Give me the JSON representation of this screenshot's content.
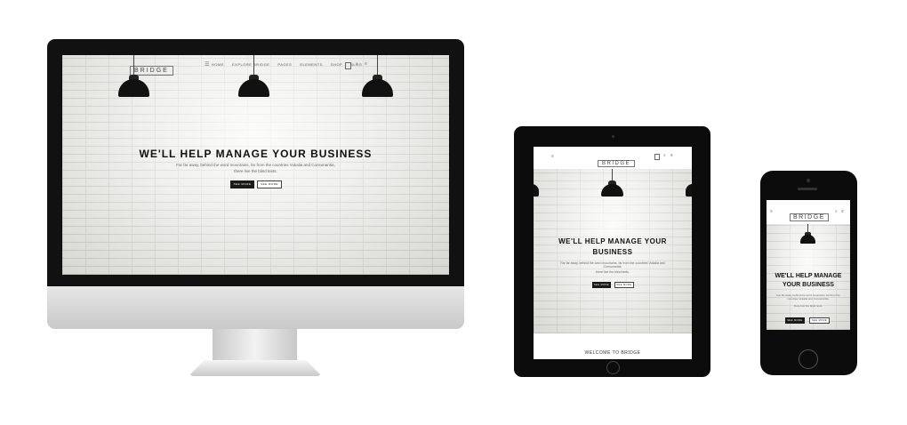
{
  "site": {
    "logo": "BRIDGE",
    "headline": "WE'LL HELP MANAGE YOUR BUSINESS",
    "headline_tablet_line1": "WE'LL HELP MANAGE YOUR",
    "headline_tablet_line2": "BUSINESS",
    "headline_phone_line1": "WE'LL HELP MANAGE",
    "headline_phone_line2": "YOUR BUSINESS",
    "subtext_line1": "Far far away, behind the word mountains, far from the countries Vokalia and Consonantia,",
    "subtext_line2": "there live the blind texts.",
    "button_1": "SEE MORE",
    "button_2": "SEE MORE",
    "welcome": "WELCOME TO BRIDGE"
  },
  "nav": {
    "items": [
      "HOME",
      "EXPLORE BRIDGE",
      "PAGES",
      "ELEMENTS",
      "SHOP",
      "BLOG"
    ]
  }
}
